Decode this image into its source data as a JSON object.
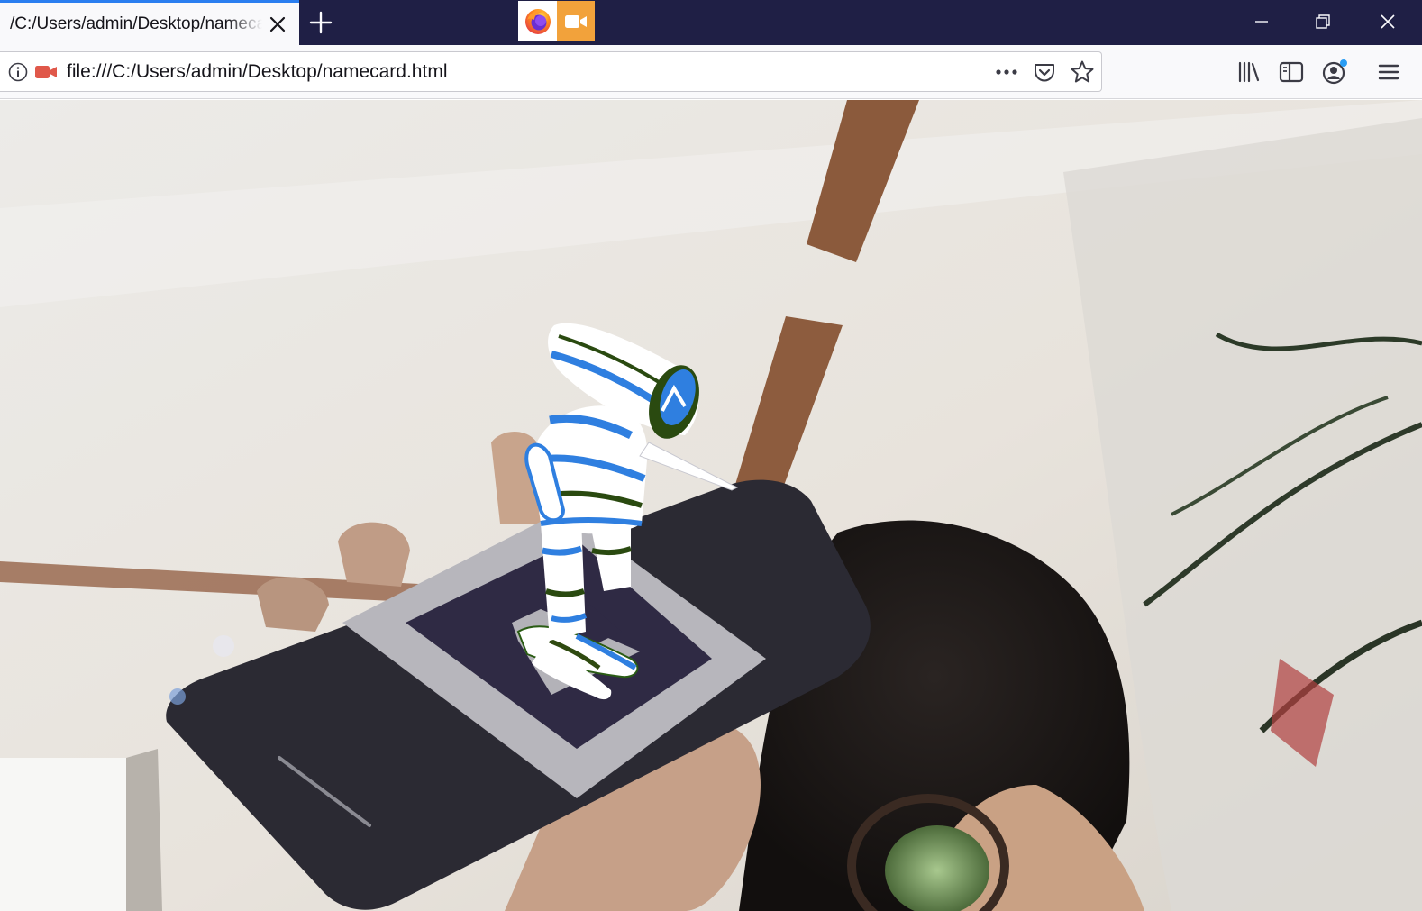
{
  "browser": {
    "tab": {
      "title": "/C:/Users/admin/Desktop/namecard.html"
    },
    "new_tab_icon": "plus-icon",
    "sharing_indicator": {
      "icons": [
        "firefox-logo-icon",
        "camera-icon"
      ],
      "accent": "#f2a23b"
    },
    "window_controls": [
      "minimize-icon",
      "restore-icon",
      "close-icon"
    ],
    "colors": {
      "titlebar": "#1f1f45",
      "tab_accent": "#2a7ef0",
      "toolbar": "#f9f9fb",
      "camera_permission": "#e0584a"
    }
  },
  "urlbar": {
    "url": "file:///C:/Users/admin/Desktop/namecard.html",
    "left_icons": [
      "info-icon",
      "camera-permission-icon"
    ],
    "right_icons": [
      "more-actions-icon",
      "pocket-icon",
      "bookmark-star-icon"
    ]
  },
  "toolbar": {
    "icons": [
      "library-icon",
      "sidebar-icon",
      "account-icon",
      "hamburger-menu-icon"
    ]
  },
  "viewport": {
    "content": "webcam AR scene",
    "marker": "hiro-style AR marker on phone screen",
    "model": "white robot figure with blue and green stripes"
  }
}
